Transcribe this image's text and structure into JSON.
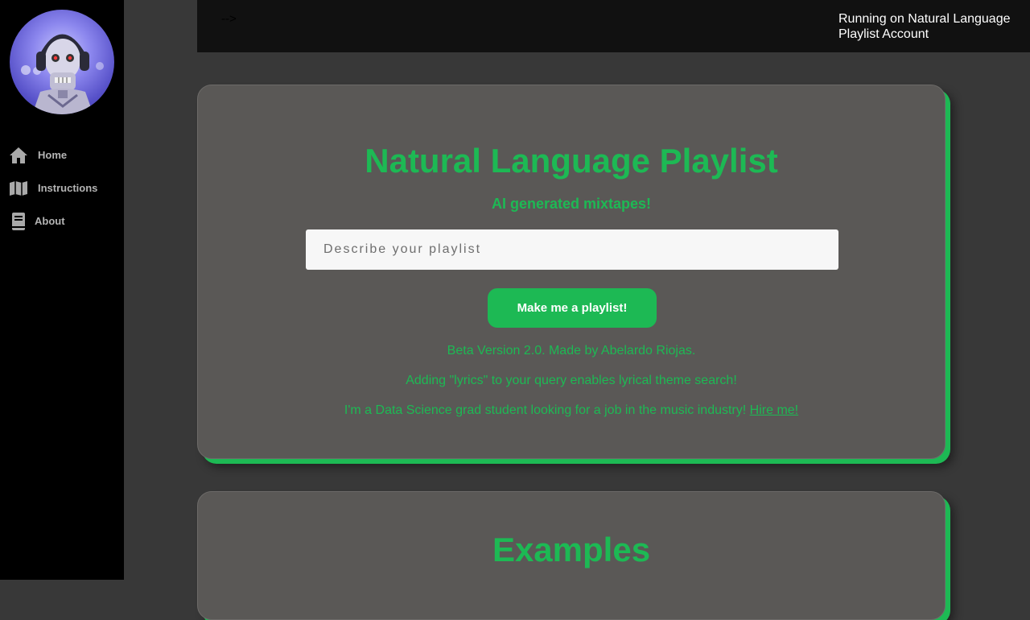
{
  "sidebar": {
    "avatar_alt": "robot-dj-avatar",
    "items": [
      {
        "label": "Home",
        "icon": "home-icon"
      },
      {
        "label": "Instructions",
        "icon": "map-icon"
      },
      {
        "label": "About",
        "icon": "book-icon"
      }
    ]
  },
  "topbar": {
    "arrow_text": "-->",
    "status_text": "Running on Natural Language Playlist Account"
  },
  "hero": {
    "title": "Natural Language Playlist",
    "subtitle": "AI generated mixtapes!",
    "search_placeholder": "Describe your playlist",
    "search_value": "",
    "button_label": "Make me a playlist!",
    "info_version": "Beta Version 2.0. Made by Abelardo Riojas.",
    "info_lyrics": "Adding \"lyrics\" to your query enables lyrical theme search!",
    "info_hire_text": "I'm a Data Science grad student looking for a job in the music industry!",
    "info_hire_link": "Hire me!"
  },
  "examples": {
    "title": "Examples"
  },
  "colors": {
    "accent": "#1db954",
    "sidebar_bg": "#000000",
    "page_bg": "#383838",
    "card_bg": "#5a5856",
    "topbar_bg": "#111111"
  }
}
